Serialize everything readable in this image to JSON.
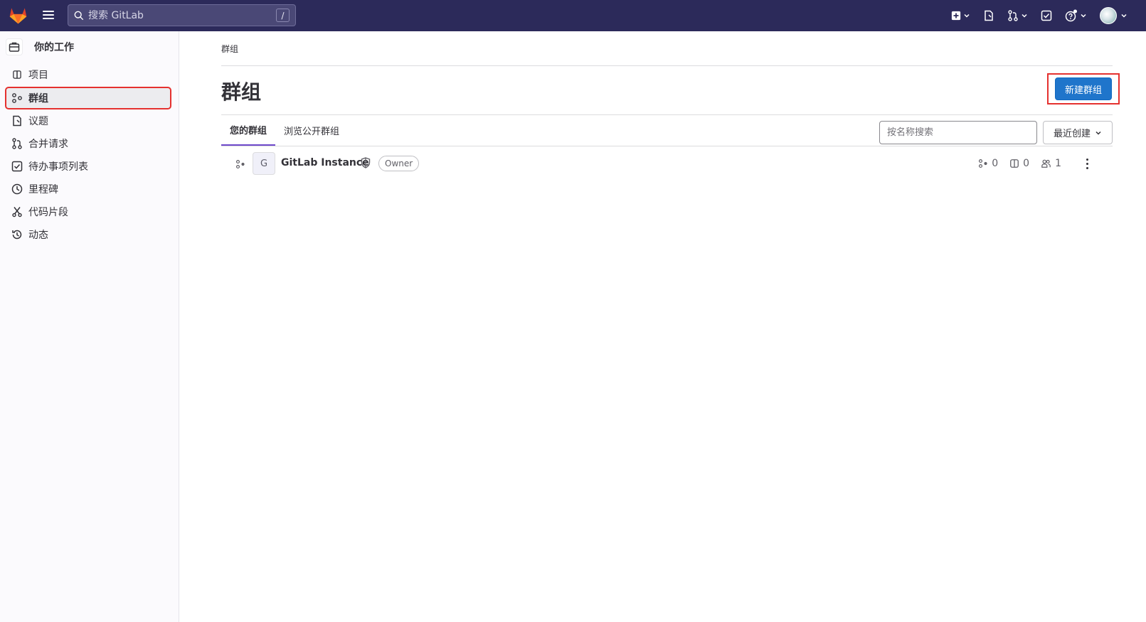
{
  "topbar": {
    "search_placeholder": "搜索 GitLab",
    "search_shortcut": "/"
  },
  "sidebar": {
    "header": "你的工作",
    "items": [
      {
        "label": "项目",
        "icon": "project-icon"
      },
      {
        "label": "群组",
        "icon": "group-icon",
        "active": true
      },
      {
        "label": "议题",
        "icon": "issues-icon"
      },
      {
        "label": "合并请求",
        "icon": "merge-request-icon"
      },
      {
        "label": "待办事项列表",
        "icon": "todo-icon"
      },
      {
        "label": "里程碑",
        "icon": "milestone-icon"
      },
      {
        "label": "代码片段",
        "icon": "snippet-icon"
      },
      {
        "label": "动态",
        "icon": "activity-icon"
      }
    ]
  },
  "main": {
    "breadcrumb": "群组",
    "title": "群组",
    "new_group_button": "新建群组",
    "tabs": [
      {
        "label": "您的群组",
        "active": true
      },
      {
        "label": "浏览公开群组",
        "active": false
      }
    ],
    "filter_placeholder": "按名称搜索",
    "sort_label": "最近创建",
    "groups": [
      {
        "avatar_letter": "G",
        "name": "GitLab Instance",
        "role": "Owner",
        "subgroups": "0",
        "projects": "0",
        "members": "1"
      }
    ]
  },
  "colors": {
    "topbar": "#2c2a5a",
    "primary_button": "#1f75cb",
    "highlight": "#e5312f",
    "tab_active": "#6e49cb"
  }
}
